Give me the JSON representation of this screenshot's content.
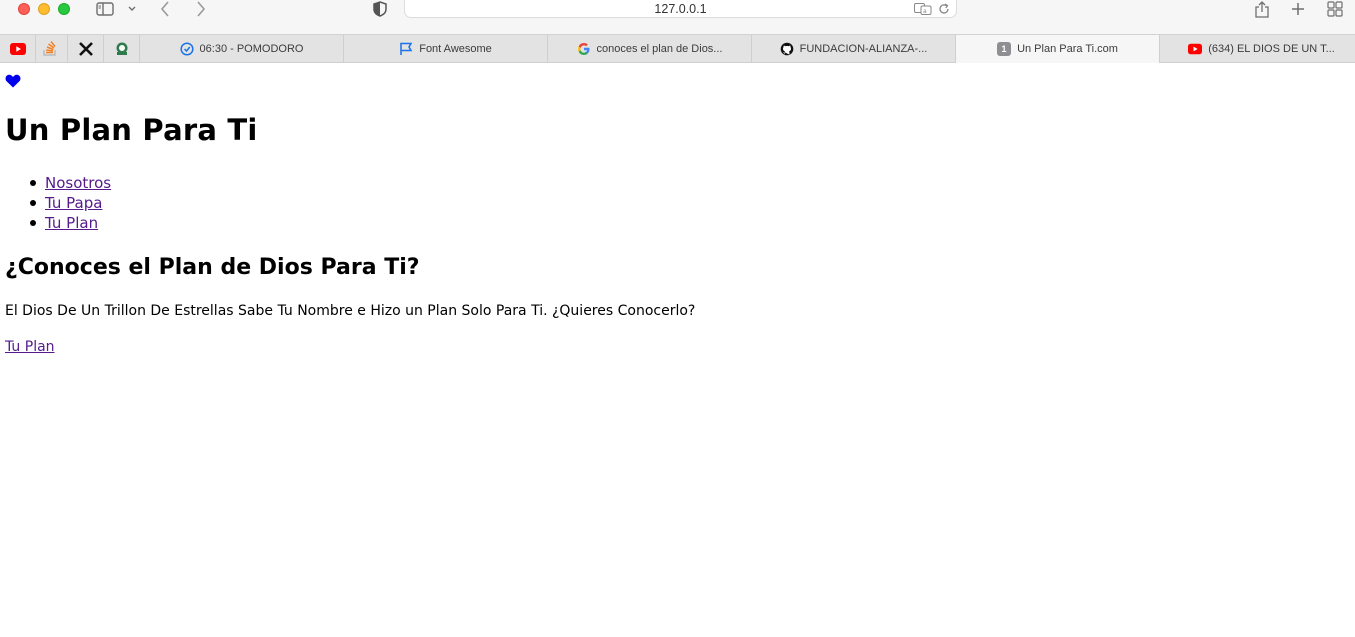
{
  "browser": {
    "address": "127.0.0.1",
    "tabs": [
      {
        "label": "06:30 - POMODORO",
        "icon": "clock-check-icon"
      },
      {
        "label": "Font Awesome",
        "icon": "flag-icon"
      },
      {
        "label": "conoces el plan de Dios...",
        "icon": "google-icon"
      },
      {
        "label": "FUNDACION-ALIANZA-...",
        "icon": "github-icon"
      },
      {
        "label": "Un Plan Para Ti.com",
        "icon": "number-badge-icon",
        "badge": "1",
        "active": true
      },
      {
        "label": "(634) EL DIOS DE UN T...",
        "icon": "youtube-icon"
      }
    ],
    "pinned": [
      "youtube-icon",
      "stackoverflow-icon",
      "x-icon",
      "badge-logo-icon"
    ]
  },
  "page": {
    "title": "Un Plan Para Ti",
    "nav": [
      "Nosotros",
      "Tu Papa",
      "Tu Plan"
    ],
    "heading": "¿Conoces el Plan de Dios Para Ti?",
    "paragraph": "El Dios De Un Trillon De Estrellas Sabe Tu Nombre e Hizo un Plan Solo Para Ti. ¿Quieres Conocerlo?",
    "cta": "Tu Plan"
  },
  "colors": {
    "link": "#551a8b",
    "heart": "#0000ee",
    "youtube": "#ff0000"
  }
}
